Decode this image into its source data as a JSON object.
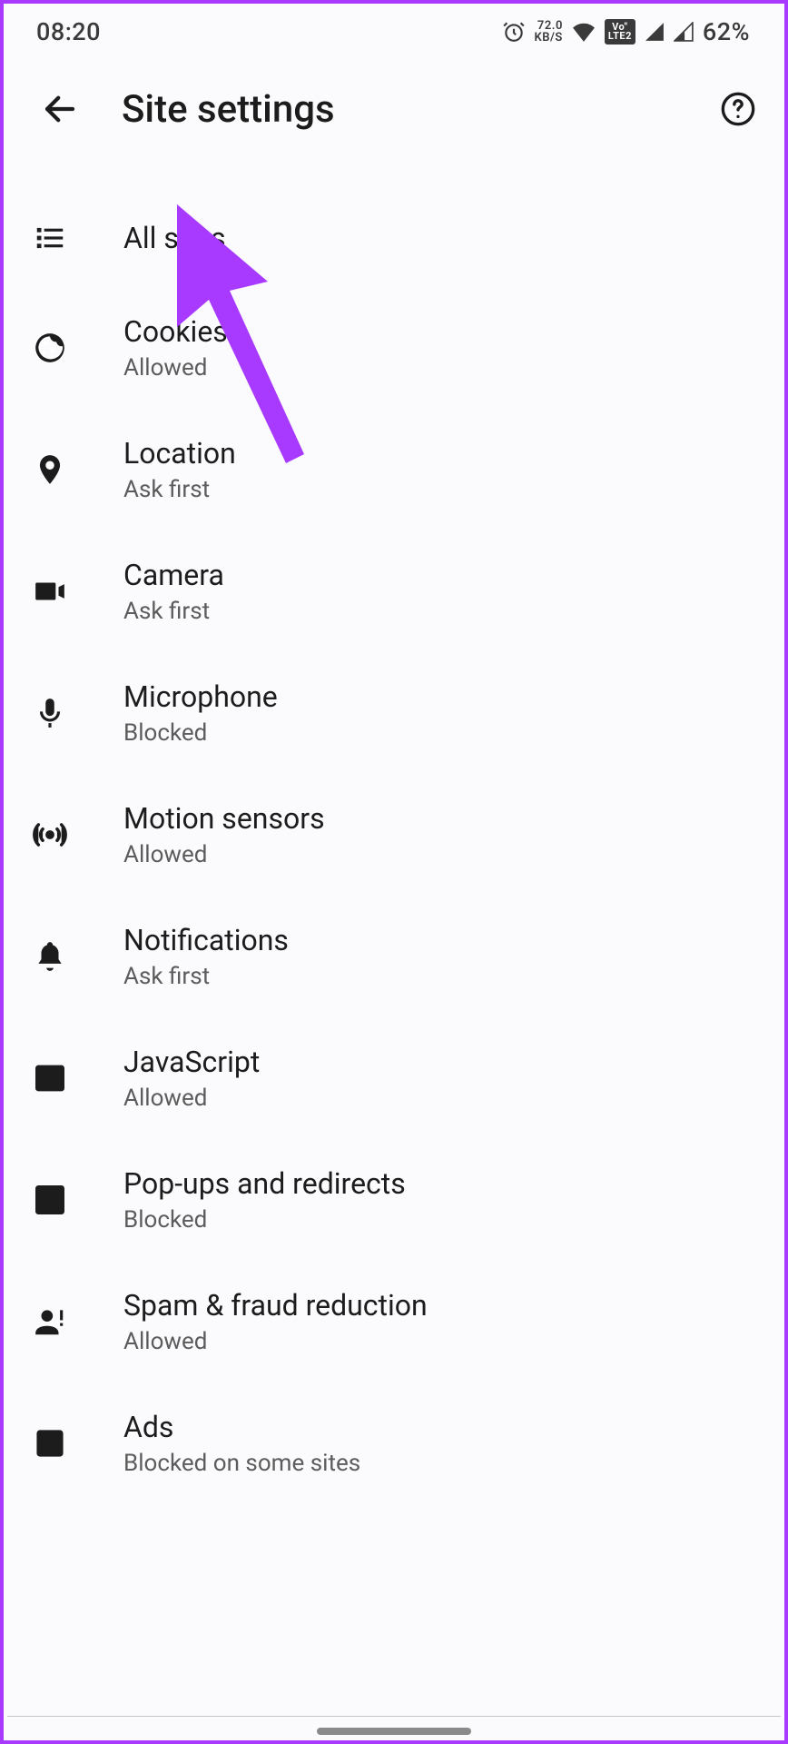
{
  "status": {
    "time": "08:20",
    "netspeed_top": "72.0",
    "netspeed_bottom": "KB/S",
    "volte_top": "Vo\"",
    "volte_bottom": "LTE2",
    "battery": "62%"
  },
  "header": {
    "title": "Site settings"
  },
  "settings": [
    {
      "icon": "all-sites",
      "label": "All sites",
      "sublabel": ""
    },
    {
      "icon": "cookie",
      "label": "Cookies",
      "sublabel": "Allowed"
    },
    {
      "icon": "location",
      "label": "Location",
      "sublabel": "Ask first"
    },
    {
      "icon": "camera",
      "label": "Camera",
      "sublabel": "Ask first"
    },
    {
      "icon": "microphone",
      "label": "Microphone",
      "sublabel": "Blocked"
    },
    {
      "icon": "motion",
      "label": "Motion sensors",
      "sublabel": "Allowed"
    },
    {
      "icon": "notifications",
      "label": "Notifications",
      "sublabel": "Ask first"
    },
    {
      "icon": "javascript",
      "label": "JavaScript",
      "sublabel": "Allowed"
    },
    {
      "icon": "popup",
      "label": "Pop-ups and redirects",
      "sublabel": "Blocked"
    },
    {
      "icon": "spam",
      "label": "Spam & fraud reduction",
      "sublabel": "Allowed"
    },
    {
      "icon": "ads",
      "label": "Ads",
      "sublabel": "Blocked on some sites"
    }
  ]
}
